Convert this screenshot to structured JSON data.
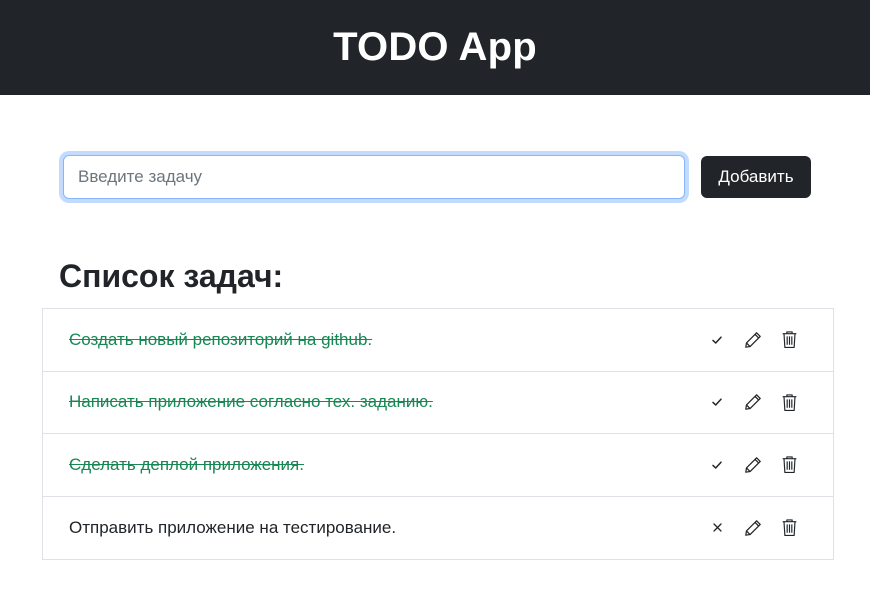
{
  "header": {
    "title": "TODO App"
  },
  "form": {
    "placeholder": "Введите задачу",
    "value": "",
    "add_label": "Добавить"
  },
  "list": {
    "title": "Список задач:",
    "items": [
      {
        "text": "Создать новый репозиторий на github.",
        "completed": true,
        "status_icon": "check-icon"
      },
      {
        "text": "Написать приложение согласно тех. заданию.",
        "completed": true,
        "status_icon": "check-icon"
      },
      {
        "text": "Сделать деплой приложения.",
        "completed": true,
        "status_icon": "check-icon"
      },
      {
        "text": "Отправить приложение на тестирование.",
        "completed": false,
        "status_icon": "close-icon"
      }
    ]
  },
  "colors": {
    "header_bg": "#212529",
    "completed_text": "#198754",
    "border": "#dee2e6",
    "focus_border": "#86b7fe"
  }
}
